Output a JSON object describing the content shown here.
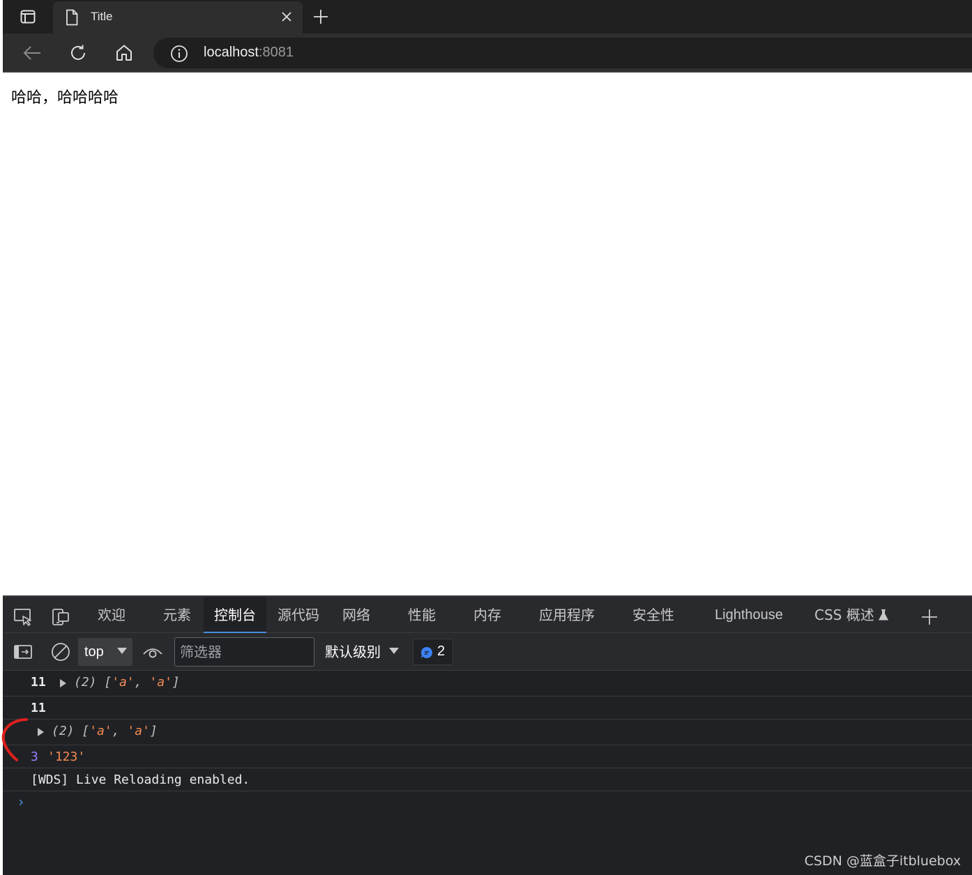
{
  "browser": {
    "tab_title": "Title",
    "address": {
      "host": "localhost",
      "port": ":8081"
    }
  },
  "page": {
    "text": "哈哈，哈哈哈哈"
  },
  "devtools": {
    "tabs": [
      "欢迎",
      "元素",
      "控制台",
      "源代码",
      "网络",
      "性能",
      "内存",
      "应用程序",
      "安全性",
      "Lighthouse",
      "CSS 概述"
    ],
    "active_tab": "控制台",
    "context": "top",
    "filter_placeholder": "筛选器",
    "log_level": "默认级别",
    "issues_count": "2",
    "console": {
      "row1": {
        "count": "11",
        "array_prefix": "(2) [",
        "items": [
          "'a'",
          "'a'"
        ]
      },
      "row2": {
        "count": "11"
      },
      "row3": {
        "array_prefix": "(2) [",
        "items": [
          "'a'",
          "'a'"
        ]
      },
      "row4": {
        "number": "3",
        "string": "'123'"
      },
      "row5": {
        "text": "[WDS] Live Reloading enabled."
      }
    }
  },
  "watermark": "CSDN @蓝盒子itbluebox",
  "colors": {
    "active_tab_underline": "#4a8fe0",
    "string_color": "#f28b54",
    "number_color": "#9980ff",
    "annotation_red": "#e0201e"
  }
}
